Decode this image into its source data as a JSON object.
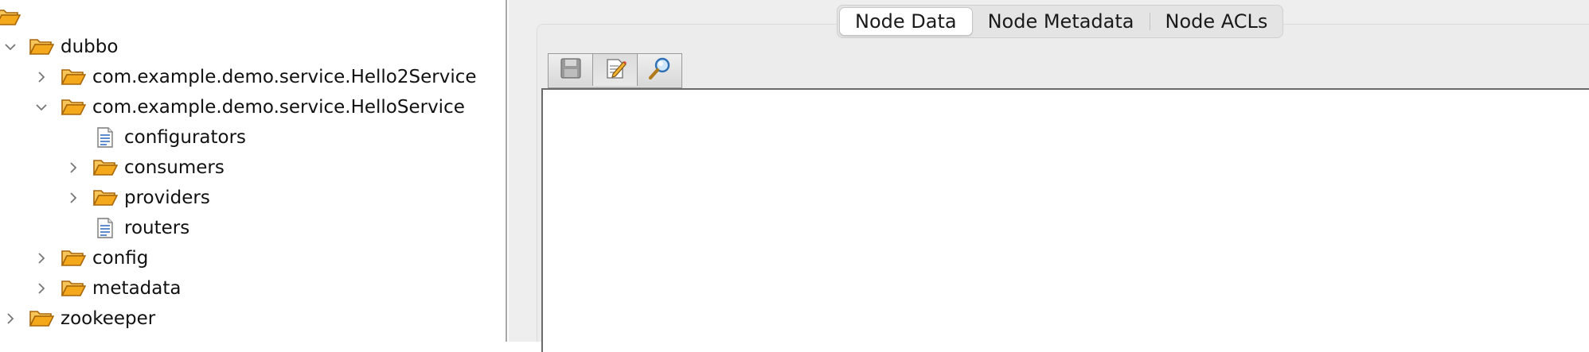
{
  "tree": {
    "root": {
      "icon": "folder-open-icon"
    },
    "nodes": [
      {
        "label": "dubbo",
        "expanded": true,
        "icon": "folder-open-icon"
      },
      {
        "label": "com.example.demo.service.Hello2Service",
        "expanded": false,
        "icon": "folder-open-icon"
      },
      {
        "label": "com.example.demo.service.HelloService",
        "expanded": true,
        "icon": "folder-open-icon"
      },
      {
        "label": "configurators",
        "icon": "document-icon"
      },
      {
        "label": "consumers",
        "expanded": false,
        "icon": "folder-open-icon"
      },
      {
        "label": "providers",
        "expanded": false,
        "icon": "folder-open-icon"
      },
      {
        "label": "routers",
        "icon": "document-icon"
      },
      {
        "label": "config",
        "expanded": false,
        "icon": "folder-open-icon"
      },
      {
        "label": "metadata",
        "expanded": false,
        "icon": "folder-open-icon"
      },
      {
        "label": "zookeeper",
        "expanded": false,
        "icon": "folder-open-icon"
      }
    ]
  },
  "tabs": [
    {
      "label": "Node Data",
      "active": true
    },
    {
      "label": "Node Metadata",
      "active": false
    },
    {
      "label": "Node ACLs",
      "active": false
    }
  ],
  "toolbar": {
    "buttons": [
      {
        "name": "save",
        "icon": "save-disk-icon",
        "enabled": false
      },
      {
        "name": "edit",
        "icon": "edit-pencil-icon",
        "enabled": true
      },
      {
        "name": "search",
        "icon": "magnifier-icon",
        "enabled": true
      }
    ]
  },
  "colors": {
    "folder": "#f3a91b",
    "folder_outline": "#a8660a",
    "pane_bg": "#eeeeee",
    "tab_active_bg": "#ffffff"
  }
}
